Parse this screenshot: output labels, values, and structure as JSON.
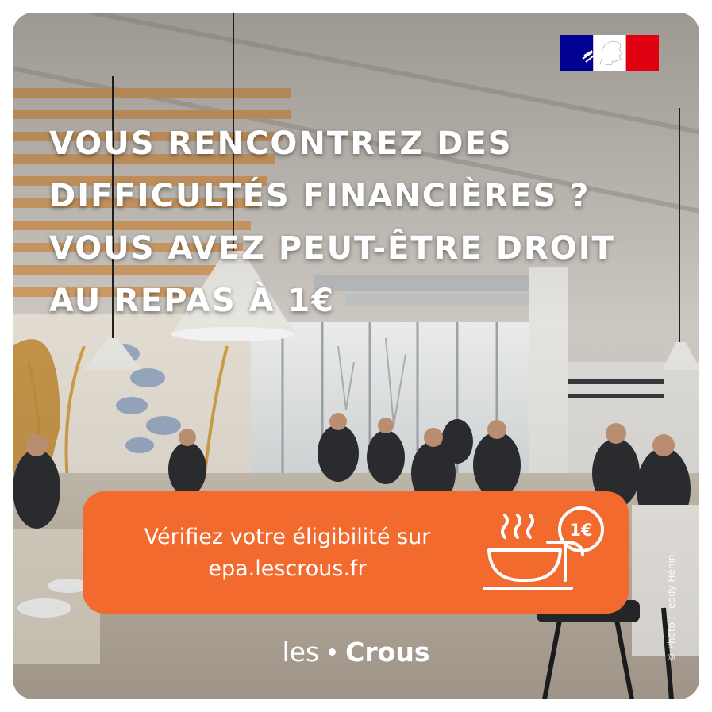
{
  "headline": {
    "lines": [
      "VOUS RENCONTREZ DES",
      "DIFFICULTÉS FINANCIÈRES ?",
      "VOUS AVEZ PEUT-ÊTRE DROIT",
      "AU REPAS À 1€"
    ]
  },
  "cta": {
    "line1": "Vérifiez votre éligibilité sur",
    "line2": "epa.lescrous.fr",
    "price_badge": "1€",
    "icon": "meal-bowl-icon"
  },
  "brand": {
    "les": "les",
    "crous": "Crous"
  },
  "photo_credit": "© Photo : Teddy Hénin",
  "colors": {
    "accent": "#f26a2e",
    "text": "#ffffff",
    "flag_blue": "#000091",
    "flag_red": "#e1000f"
  }
}
